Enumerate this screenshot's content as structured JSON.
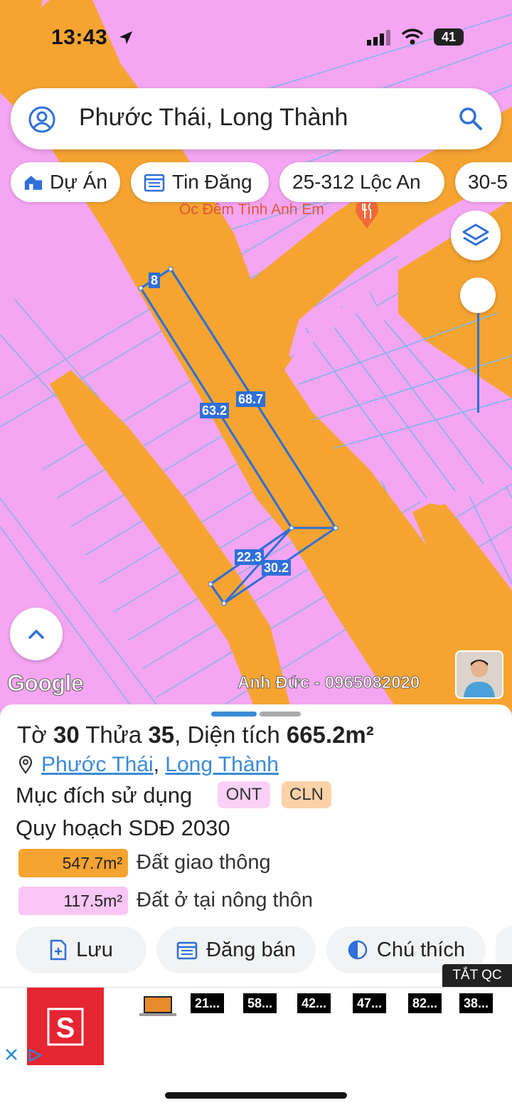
{
  "status": {
    "time": "13:43",
    "battery": "41"
  },
  "search": {
    "value": "Phước Thái, Long Thành"
  },
  "chips": [
    {
      "label": "Dự Án",
      "icon": "home-building-icon"
    },
    {
      "label": "Tin Đăng",
      "icon": "calendar-list-icon"
    },
    {
      "label": "25-312 Lộc An"
    },
    {
      "label": "30-5"
    }
  ],
  "map": {
    "poi": "Ốc Đêm Tình Anh Em",
    "edges": [
      "8",
      "63.2",
      "68.7",
      "22.3",
      "30.2"
    ],
    "google": "Google",
    "owner": "Anh Đức - 0965082020"
  },
  "parcel": {
    "title_prefix": "Tờ ",
    "sheet": "30",
    "mid1": " Thửa ",
    "plot": "35",
    "mid2": ", Diện tích ",
    "area": "665.2m²",
    "ward": "Phước Thái",
    "district": "Long Thành",
    "purpose_label": "Mục đích sử dụng",
    "purpose_tags": [
      "ONT",
      "CLN"
    ],
    "plan_label": "Quy hoạch SDĐ 2030",
    "plan_items": [
      {
        "area": "547.7m²",
        "label": "Đất giao thông",
        "color": "#f6a431"
      },
      {
        "area": "117.5m²",
        "label": "Đất ở tại nông thôn",
        "color": "#f9c6f5"
      }
    ]
  },
  "actions": {
    "save": "Lưu",
    "post": "Đăng bán",
    "legend": "Chú thích"
  },
  "ad": {
    "hide_label": "TẮT QC",
    "prices": [
      "21...",
      "58...",
      "42...",
      "47...",
      "82...",
      "38..."
    ]
  },
  "colors": {
    "accent": "#2f6fd8",
    "road": "#f6a431",
    "residential": "#f4a6f2"
  }
}
